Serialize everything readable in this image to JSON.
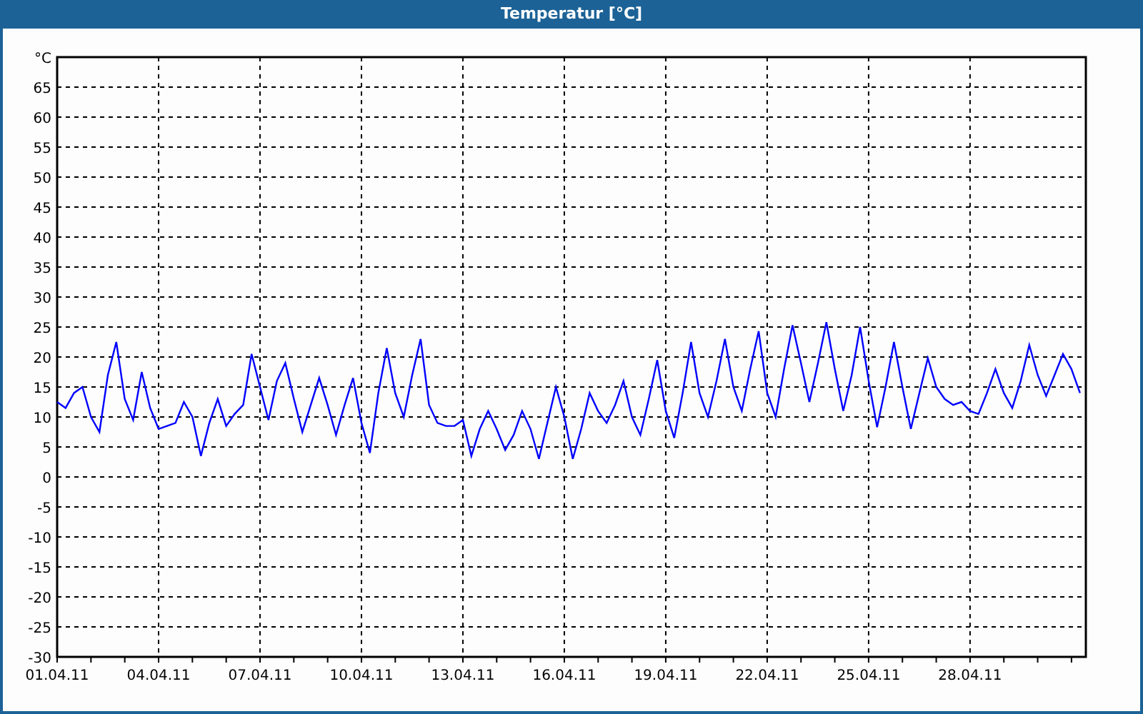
{
  "chart": {
    "chart_data": {
      "type": "line",
      "title": "Temperatur [°C]",
      "ylabel": "°C",
      "grid": true,
      "ylim": [
        -30,
        70
      ],
      "yticks": [
        -30,
        -25,
        -20,
        -15,
        -10,
        -5,
        0,
        5,
        10,
        15,
        20,
        25,
        30,
        35,
        40,
        45,
        50,
        55,
        60,
        65
      ],
      "categories": [
        "01.04.11",
        null,
        null,
        null,
        null,
        null,
        null,
        null,
        null,
        null,
        null,
        null,
        "04.04.11",
        null,
        null,
        null,
        null,
        null,
        null,
        null,
        null,
        null,
        null,
        null,
        "07.04.11",
        null,
        null,
        null,
        null,
        null,
        null,
        null,
        null,
        null,
        null,
        null,
        "10.04.11",
        null,
        null,
        null,
        null,
        null,
        null,
        null,
        null,
        null,
        null,
        null,
        "13.04.11",
        null,
        null,
        null,
        null,
        null,
        null,
        null,
        null,
        null,
        null,
        null,
        "16.04.11",
        null,
        null,
        null,
        null,
        null,
        null,
        null,
        null,
        null,
        null,
        null,
        "19.04.11",
        null,
        null,
        null,
        null,
        null,
        null,
        null,
        null,
        null,
        null,
        null,
        "22.04.11",
        null,
        null,
        null,
        null,
        null,
        null,
        null,
        null,
        null,
        null,
        null,
        "25.04.11",
        null,
        null,
        null,
        null,
        null,
        null,
        null,
        null,
        null,
        null,
        null,
        "28.04.11",
        null,
        null,
        null,
        null,
        null,
        null,
        null,
        null,
        null,
        null,
        null,
        null,
        null
      ],
      "series": [
        {
          "color": "#0000ff",
          "values": [
            12.5,
            11.5,
            14,
            15,
            10,
            7.5,
            17,
            22.5,
            13,
            9.5,
            17.5,
            11.5,
            8,
            8.5,
            9,
            12.5,
            10,
            3.5,
            9,
            13,
            8.5,
            10.5,
            12,
            20.5,
            15,
            9.5,
            16,
            19,
            13,
            7.5,
            12,
            16.5,
            12,
            7,
            12,
            16.5,
            9,
            4,
            14,
            21.5,
            14,
            10,
            17,
            23,
            12,
            9,
            8.5,
            8.5,
            9.5,
            3.5,
            8,
            11,
            8,
            4.5,
            7,
            11,
            8,
            3,
            9,
            15,
            10,
            3,
            8,
            14,
            11,
            9,
            12,
            16,
            10,
            7,
            13,
            19.5,
            11,
            6.5,
            14,
            22.5,
            14,
            10,
            16,
            23,
            15,
            11,
            18,
            24.3,
            14,
            10,
            18,
            25.3,
            19,
            12.5,
            19,
            25.8,
            18,
            11,
            17,
            25,
            16,
            8.3,
            15,
            22.5,
            15,
            8,
            14,
            19.8,
            15,
            13,
            12,
            12.5,
            11,
            10.5,
            14,
            18,
            14,
            11.5,
            16,
            22,
            17,
            13.5,
            17,
            20.5,
            18,
            14
          ]
        }
      ]
    }
  }
}
